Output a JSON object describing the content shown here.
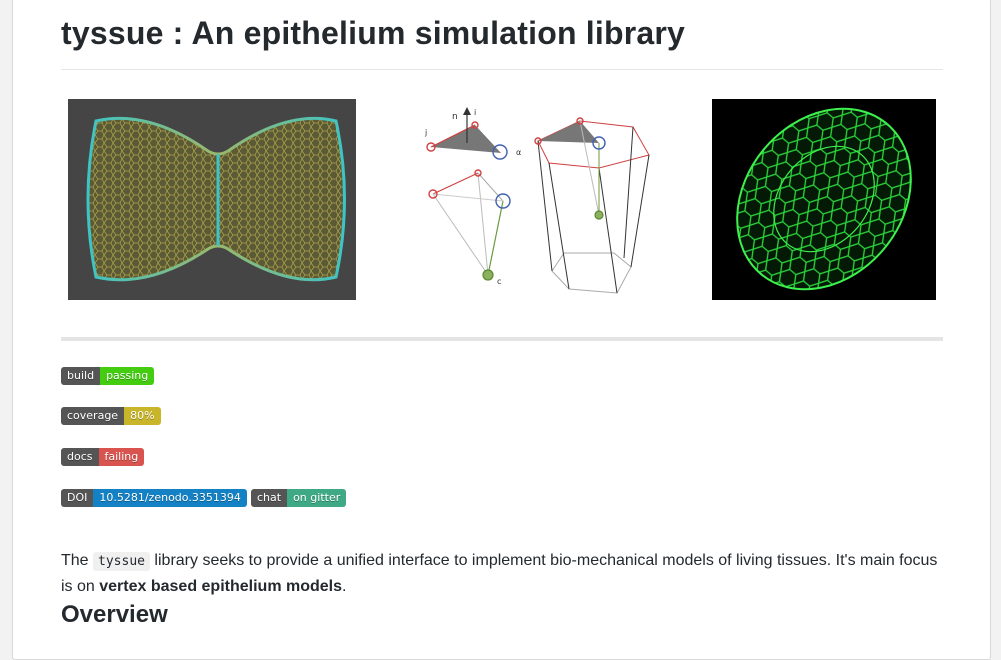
{
  "title": "tyssue : An epithelium simulation library",
  "figures": [
    {
      "name": "monolayer-mesh-rendering"
    },
    {
      "name": "vertex-geometry-diagram",
      "labels": {
        "n": "n",
        "i": "i",
        "j": "j",
        "alpha": "α",
        "c": "c"
      }
    },
    {
      "name": "3d-cell-mesh-rendering"
    }
  ],
  "badges": [
    {
      "left": "build",
      "right": "passing",
      "color": "#4c1"
    },
    {
      "left": "coverage",
      "right": "80%",
      "color": "#c9b52a"
    },
    {
      "left": "docs",
      "right": "failing",
      "color": "#d9534f"
    },
    {
      "left": "DOI",
      "right": "10.5281/zenodo.3351394",
      "color": "#1381c4"
    },
    {
      "left": "chat",
      "right": "on gitter",
      "color": "#3fa986"
    }
  ],
  "intro": {
    "pre": "The ",
    "code": "tyssue",
    "mid": " library seeks to provide a unified interface to implement bio-mechanical models of living tissues. It's main focus is on ",
    "strong": "vertex based epithelium models",
    "post": "."
  },
  "overview_heading": "Overview"
}
